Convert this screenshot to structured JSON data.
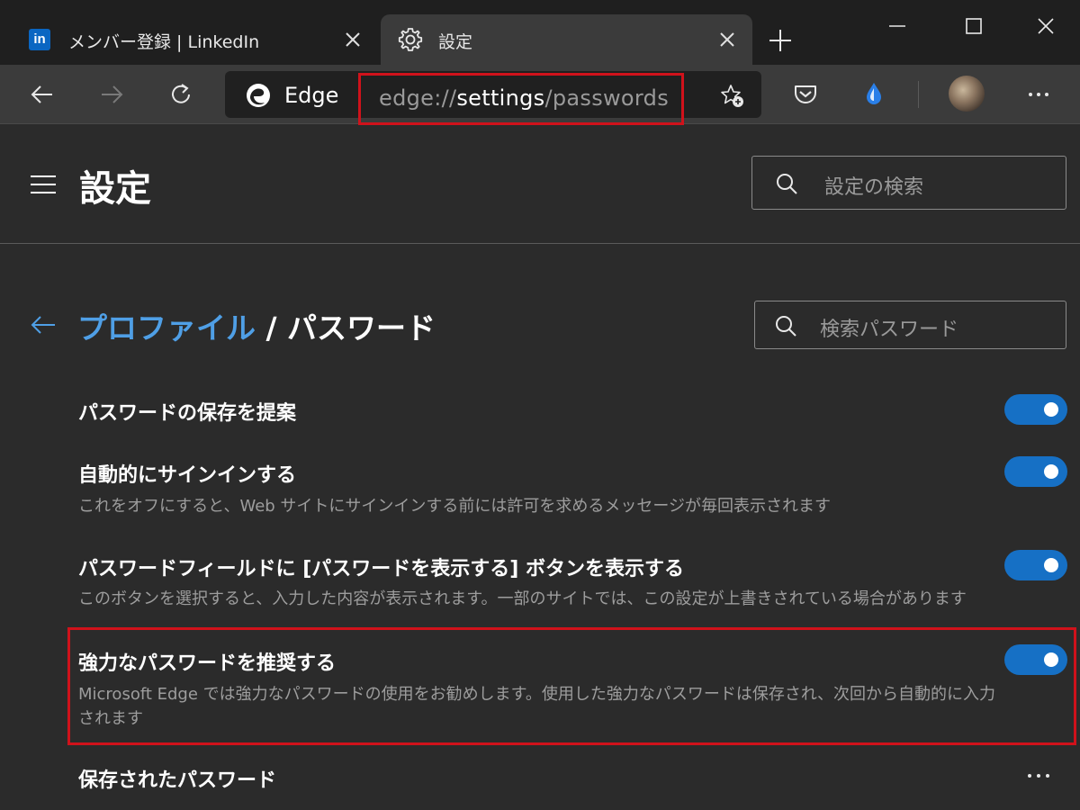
{
  "tabs": [
    {
      "title": "メンバー登録 | LinkedIn",
      "icon": "linkedin-icon",
      "logo_text": "in"
    },
    {
      "title": "設定",
      "icon": "gear-icon"
    }
  ],
  "toolbar": {
    "edge_label": "Edge",
    "url": {
      "scheme": "edge://",
      "host": "settings",
      "path": "/passwords"
    }
  },
  "header": {
    "title": "設定",
    "search_placeholder": "設定の検索"
  },
  "content": {
    "breadcrumb": {
      "parent": "プロファイル",
      "separator": " / ",
      "current": "パスワード"
    },
    "search_placeholder": "検索パスワード",
    "settings": [
      {
        "title": "パスワードの保存を提案",
        "description": "",
        "enabled": true
      },
      {
        "title": "自動的にサインインする",
        "description": "これをオフにすると、Web サイトにサインインする前には許可を求めるメッセージが毎回表示されます",
        "enabled": true
      },
      {
        "title": "パスワードフィールドに [パスワードを表示する] ボタンを表示する",
        "description": "このボタンを選択すると、入力した内容が表示されます。一部のサイトでは、この設定が上書きされている場合があります",
        "enabled": true
      },
      {
        "title": "強力なパスワードを推奨する",
        "description_line1": "Microsoft Edge では強力なパスワードの使用をお勧めします。使用した強力なパスワードは保存され、次回から自動的に入力",
        "description_line2": "されます",
        "enabled": true
      }
    ],
    "saved_passwords_title": "保存されたパスワード"
  },
  "colors": {
    "accent": "#1670c5",
    "link": "#4f9fe6",
    "highlight": "#d0121b",
    "background": "#2b2b2b"
  }
}
